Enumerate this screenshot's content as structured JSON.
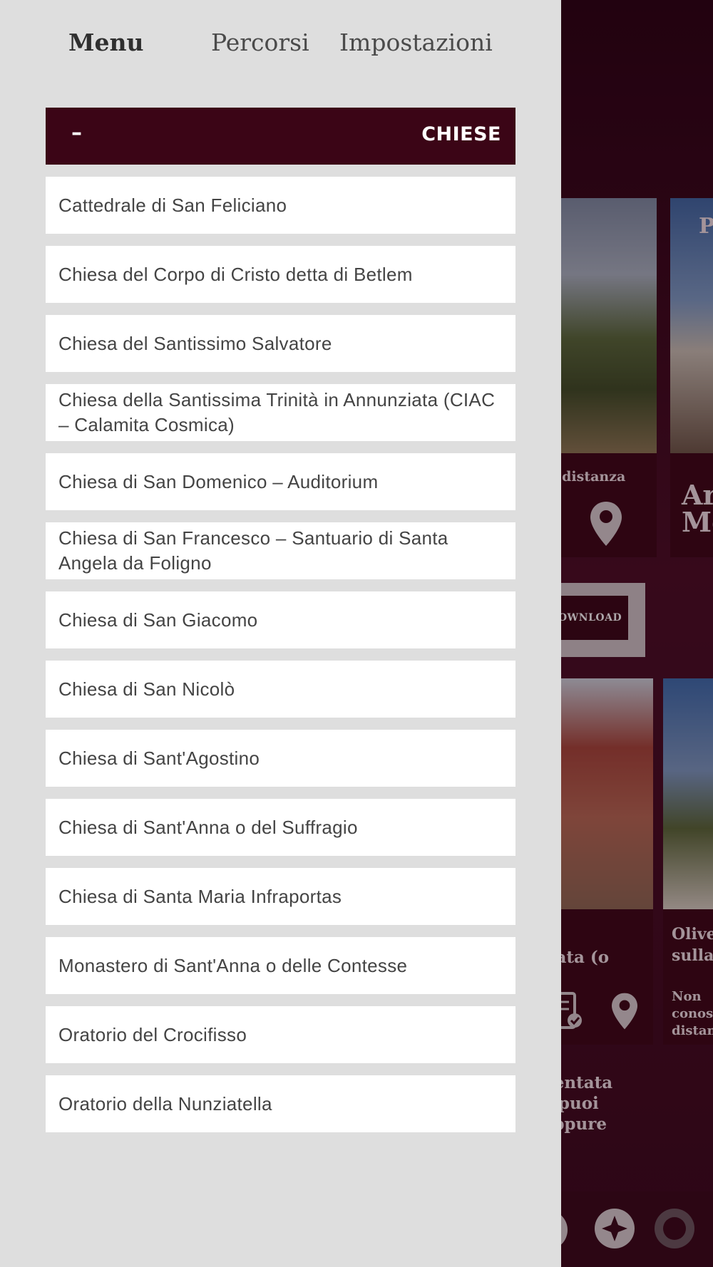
{
  "drawer": {
    "tabs": [
      {
        "label": "Menu"
      },
      {
        "label": "Percorsi"
      },
      {
        "label": "Impostazioni"
      }
    ],
    "category": {
      "collapse_symbol": "–",
      "title": "CHIESE"
    },
    "items": [
      {
        "label": "Cattedrale di San Feliciano"
      },
      {
        "label": "Chiesa del Corpo di Cristo detta di Betlem"
      },
      {
        "label": "Chiesa del Santissimo Salvatore"
      },
      {
        "label": "Chiesa della Santissima Trinità in Annunziata (CIAC – Calamita Cosmica)"
      },
      {
        "label": "Chiesa di San Domenico – Auditorium"
      },
      {
        "label": "Chiesa di San Francesco – Santuario di Santa Angela da Foligno"
      },
      {
        "label": "Chiesa di San Giacomo"
      },
      {
        "label": "Chiesa di San Nicolò"
      },
      {
        "label": "Chiesa di Sant'Agostino"
      },
      {
        "label": "Chiesa di Sant'Anna o del Suffragio"
      },
      {
        "label": "Chiesa di Santa Maria Infraportas"
      },
      {
        "label": "Monastero di Sant'Anna o delle Contesse"
      },
      {
        "label": "Oratorio del Crocifisso"
      },
      {
        "label": "Oratorio della Nunziatella"
      }
    ]
  },
  "background": {
    "card1_caption": "la distanza",
    "card2_title_fragment": "P",
    "card2_caption_fragment_1": "Ar",
    "card2_caption_fragment_2": "Me",
    "download_label": "OWNLOAD",
    "card3_caption": "llata (o",
    "card4_caption_1": "Olive",
    "card4_caption_2": "sulla",
    "card4_note_1": "Non",
    "card4_note_2": "conosc",
    "card4_note_3": "distan",
    "text_fragment_1": "nentata",
    "text_fragment_2": "a puoi",
    "text_fragment_3": "oppure"
  },
  "colors": {
    "accent": "#3b0516",
    "drawer_bg": "#dedede",
    "item_bg": "#ffffff"
  }
}
